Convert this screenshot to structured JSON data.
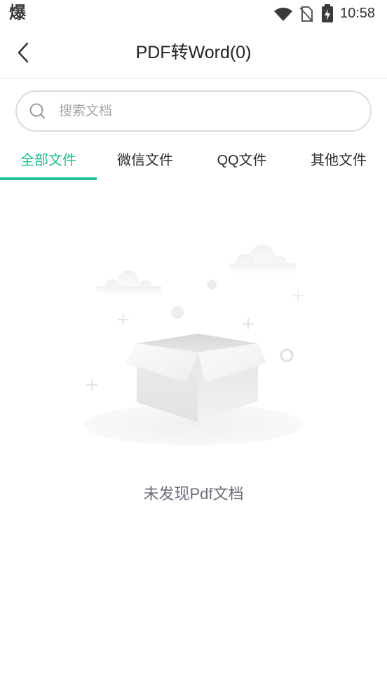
{
  "status_bar": {
    "app_glyph": "爆",
    "time": "10:58",
    "icons": [
      "wifi-icon",
      "no-sim-icon",
      "battery-charging-icon"
    ]
  },
  "header": {
    "back_icon": "back-chevron-icon",
    "title": "PDF转Word(0)"
  },
  "search": {
    "icon": "search-icon",
    "placeholder": "搜索文档",
    "value": ""
  },
  "tabs": [
    {
      "label": "全部文件",
      "active": true
    },
    {
      "label": "微信文件",
      "active": false
    },
    {
      "label": "QQ文件",
      "active": false
    },
    {
      "label": "其他文件",
      "active": false
    }
  ],
  "empty_state": {
    "illustration": "empty-box-illustration",
    "message": "未发现Pdf文档"
  },
  "colors": {
    "accent": "#1dbf94",
    "text_primary": "#222222",
    "empty_text": "#6e6e7e"
  }
}
